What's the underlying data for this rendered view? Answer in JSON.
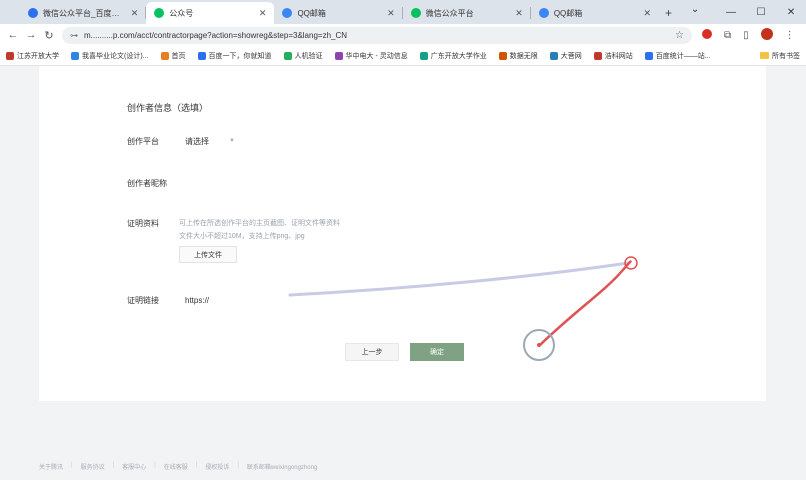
{
  "tabs": [
    {
      "title": "微信公众平台_百度搜索",
      "favicon_color": "#2d6ff0"
    },
    {
      "title": "公众号",
      "favicon_color": "#07c160",
      "active": true
    },
    {
      "title": "QQ邮箱",
      "favicon_color": "#3b86f5"
    },
    {
      "title": "微信公众平台",
      "favicon_color": "#07c160"
    },
    {
      "title": "QQ邮箱",
      "favicon_color": "#3b86f5"
    }
  ],
  "address_bar": {
    "url": "m..........p.com/acct/contractorpage?action=showreg&step=3&lang=zh_CN"
  },
  "bookmarks": [
    {
      "label": "江苏开放大学",
      "color": "#c0392b"
    },
    {
      "label": "我喜毕业论文(设计)...",
      "color": "#2e86de"
    },
    {
      "label": "首页",
      "color": "#e67e22"
    },
    {
      "label": "百度一下，你就知道",
      "color": "#2d6ff0"
    },
    {
      "label": "人机验证",
      "color": "#27ae60"
    },
    {
      "label": "华中电大 - 灵动信息",
      "color": "#8e44ad"
    },
    {
      "label": "广东开放大学作业",
      "color": "#16a085"
    },
    {
      "label": "数据无限",
      "color": "#d35400"
    },
    {
      "label": "大菩网",
      "color": "#2980b9"
    },
    {
      "label": "浩科网站",
      "color": "#c0392b"
    },
    {
      "label": "百度统计——站...",
      "color": "#2d6ff0"
    }
  ],
  "bookmarks_all": "所有书签",
  "form": {
    "section_title": "创作者信息（选填）",
    "platform_label": "创作平台",
    "platform_value": "请选择",
    "nickname_label": "创作者昵称",
    "proof_label": "证明资料",
    "proof_hint_line1": "可上传在所选创作平台的主页截图、证明文件等资料",
    "proof_hint_line2": "文件大小不超过10M，支持上传png、jpg",
    "upload_label": "上传文件",
    "link_label": "证明链接",
    "link_value": "https://",
    "prev_label": "上一步",
    "next_label": "确定",
    "accent_color": "#7fa184"
  },
  "footer": [
    "关于腾讯",
    "服务协议",
    "客服中心",
    "在线客服",
    "侵权投诉",
    "联系邮箱weixingongzhong"
  ]
}
